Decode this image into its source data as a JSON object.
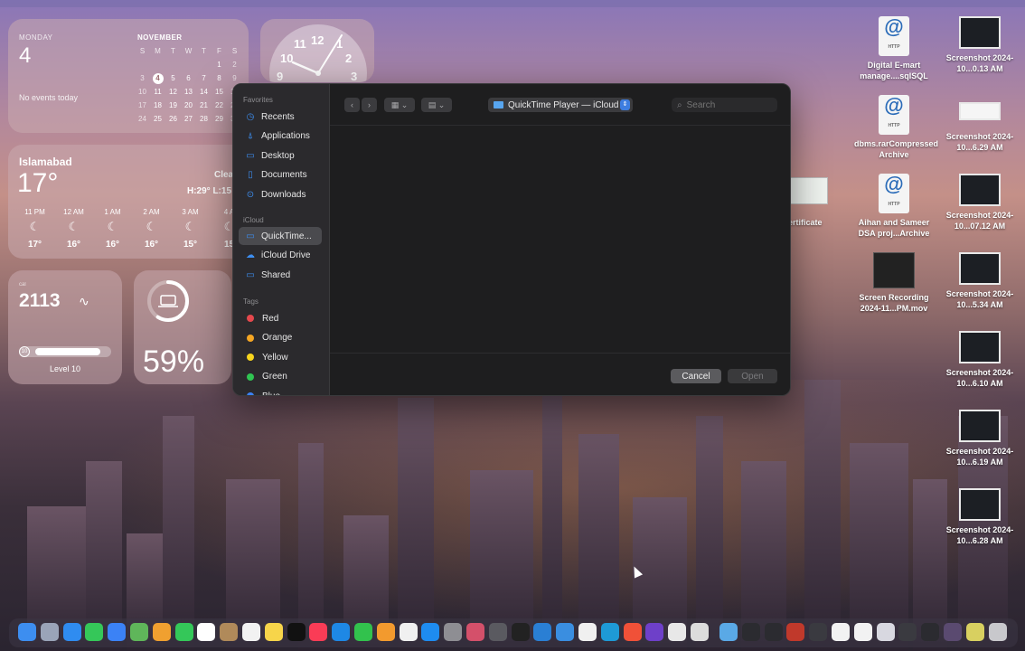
{
  "calendar": {
    "weekday": "MONDAY",
    "day": "4",
    "no_events": "No events today",
    "month": "NOVEMBER",
    "headers": [
      "S",
      "M",
      "T",
      "W",
      "T",
      "F",
      "S"
    ],
    "rows": [
      [
        "",
        "",
        "",
        "",
        "",
        "1",
        "2"
      ],
      [
        "3",
        "4",
        "5",
        "6",
        "7",
        "8",
        "9"
      ],
      [
        "10",
        "11",
        "12",
        "13",
        "14",
        "15",
        "16"
      ],
      [
        "17",
        "18",
        "19",
        "20",
        "21",
        "22",
        "23"
      ],
      [
        "24",
        "25",
        "26",
        "27",
        "28",
        "29",
        "30"
      ]
    ]
  },
  "clock": {
    "numbers": [
      "12",
      "11",
      "1",
      "10",
      "2",
      "9",
      "3"
    ]
  },
  "weather": {
    "city": "Islamabad",
    "temp": "17°",
    "condition": "Clea",
    "high_low": "H:29° L:15",
    "hours": [
      {
        "time": "11 PM",
        "temp": "17°"
      },
      {
        "time": "12 AM",
        "temp": "16°"
      },
      {
        "time": "1 AM",
        "temp": "16°"
      },
      {
        "time": "2 AM",
        "temp": "16°"
      },
      {
        "time": "3 AM",
        "temp": "15°"
      },
      {
        "time": "4 A",
        "temp": "15"
      }
    ]
  },
  "steps": {
    "label": "cal",
    "value": "2113",
    "level_badge": "10",
    "level_label": "Level 10",
    "level_fraction": 0.9
  },
  "battery": {
    "percent": "59%",
    "fraction": 0.59
  },
  "desktop": {
    "items": [
      {
        "label": "Digital E-mart manage....sqlSQL",
        "kind": "doc",
        "badge": "@",
        "sub": "HTTP"
      },
      {
        "label": "Screenshot 2024-10...0.13 AM",
        "kind": "shot"
      },
      {
        "label": "dbms.rarCompressed Archive",
        "kind": "doc",
        "badge": "@",
        "sub": "HTTP"
      },
      {
        "label": "Screenshot 2024-10...6.29 AM",
        "kind": "shot-light"
      },
      {
        "label": "Aihan and Sameer DSA proj...Archive",
        "kind": "doc",
        "badge": "@",
        "sub": "HTTP"
      },
      {
        "label": "Screenshot 2024-10...07.12 AM",
        "kind": "shot"
      },
      {
        "label": "Screen Recording 2024-11...PM.mov",
        "kind": "video"
      },
      {
        "label": "Screenshot 2024-10...5.34 AM",
        "kind": "shot"
      },
      {
        "label": "Screenshot 2024-10...6.10 AM",
        "kind": "shot"
      },
      {
        "label": "Screenshot 2024-10...6.19 AM",
        "kind": "shot"
      },
      {
        "label": "Screenshot 2024-10...6.28 AM",
        "kind": "shot"
      },
      {
        "label": "ertificate",
        "kind": "cert"
      }
    ]
  },
  "dialog": {
    "sidebar": {
      "favorites_label": "Favorites",
      "favorites": [
        {
          "label": "Recents",
          "icon": "clock-icon"
        },
        {
          "label": "Applications",
          "icon": "applications-icon"
        },
        {
          "label": "Desktop",
          "icon": "desktop-icon"
        },
        {
          "label": "Documents",
          "icon": "document-icon"
        },
        {
          "label": "Downloads",
          "icon": "download-icon"
        }
      ],
      "icloud_label": "iCloud",
      "icloud": [
        {
          "label": "QuickTime...",
          "icon": "folder-icon",
          "selected": true
        },
        {
          "label": "iCloud Drive",
          "icon": "cloud-icon"
        },
        {
          "label": "Shared",
          "icon": "shared-folder-icon"
        }
      ],
      "tags_label": "Tags",
      "tags": [
        {
          "label": "Red",
          "color": "#e5484d"
        },
        {
          "label": "Orange",
          "color": "#f5a623"
        },
        {
          "label": "Yellow",
          "color": "#f7d51d"
        },
        {
          "label": "Green",
          "color": "#30c552"
        },
        {
          "label": "Blue",
          "color": "#3b82f6"
        }
      ]
    },
    "location": "QuickTime Player — iCloud",
    "search_placeholder": "Search",
    "cancel_label": "Cancel",
    "open_label": "Open"
  },
  "dock": {
    "apps": [
      {
        "name": "finder-icon",
        "color": "#3d8ef0"
      },
      {
        "name": "launchpad-icon",
        "color": "#9aa4b8"
      },
      {
        "name": "safari-icon",
        "color": "#2f8cf0"
      },
      {
        "name": "messages-icon",
        "color": "#35c759"
      },
      {
        "name": "mail-icon",
        "color": "#3b82f6"
      },
      {
        "name": "maps-icon",
        "color": "#5fb65a"
      },
      {
        "name": "photos-icon",
        "color": "#f0a030"
      },
      {
        "name": "facetime-icon",
        "color": "#34c759"
      },
      {
        "name": "calendar-icon",
        "color": "#ffffff"
      },
      {
        "name": "contacts-icon",
        "color": "#b08a5a"
      },
      {
        "name": "reminders-icon",
        "color": "#f2f2f2"
      },
      {
        "name": "notes-icon",
        "color": "#f7d54a"
      },
      {
        "name": "tv-icon",
        "color": "#111111"
      },
      {
        "name": "music-icon",
        "color": "#fa3c56"
      },
      {
        "name": "keynote-icon",
        "color": "#1e88e5"
      },
      {
        "name": "numbers-icon",
        "color": "#32c24d"
      },
      {
        "name": "pages-icon",
        "color": "#f29a2e"
      },
      {
        "name": "chatgpt-icon",
        "color": "#f0f0f0"
      },
      {
        "name": "app-store-icon",
        "color": "#1e8cf0"
      },
      {
        "name": "settings-icon",
        "color": "#8e8e93"
      },
      {
        "name": "preview-icon",
        "color": "#d4506a"
      },
      {
        "name": "xcode-icon",
        "color": "#5a5a60"
      },
      {
        "name": "terminal-icon",
        "color": "#222222"
      },
      {
        "name": "vscode-icon",
        "color": "#2a7fd4"
      },
      {
        "name": "pycharm-icon",
        "color": "#3a8ee0"
      },
      {
        "name": "mongodb-icon",
        "color": "#f0f0f0"
      },
      {
        "name": "vscode-insiders-icon",
        "color": "#1e9ad6"
      },
      {
        "name": "swift-icon",
        "color": "#f05138"
      },
      {
        "name": "github-icon",
        "color": "#6e40c9"
      },
      {
        "name": "chrome-icon",
        "color": "#e8e8e8"
      },
      {
        "name": "quicktime-icon",
        "color": "#dcdcdc"
      },
      {
        "name": "downloads-folder-icon",
        "color": "#5aa9e6"
      },
      {
        "name": "stack-icon",
        "color": "#2b2b30"
      },
      {
        "name": "stack-icon",
        "color": "#2b2b30"
      },
      {
        "name": "stack-icon",
        "color": "#c0392b"
      },
      {
        "name": "stack-icon",
        "color": "#3a3a40"
      },
      {
        "name": "stack-icon",
        "color": "#f2f2f2"
      },
      {
        "name": "stack-icon",
        "color": "#f2f2f2"
      },
      {
        "name": "stack-icon",
        "color": "#d8d8e0"
      },
      {
        "name": "stack-icon",
        "color": "#3a3a40"
      },
      {
        "name": "stack-icon",
        "color": "#2b2b30"
      },
      {
        "name": "stack-icon",
        "color": "#5a4a70"
      },
      {
        "name": "stack-icon",
        "color": "#d8d060"
      },
      {
        "name": "trash-icon",
        "color": "#c8c8cc"
      }
    ]
  }
}
